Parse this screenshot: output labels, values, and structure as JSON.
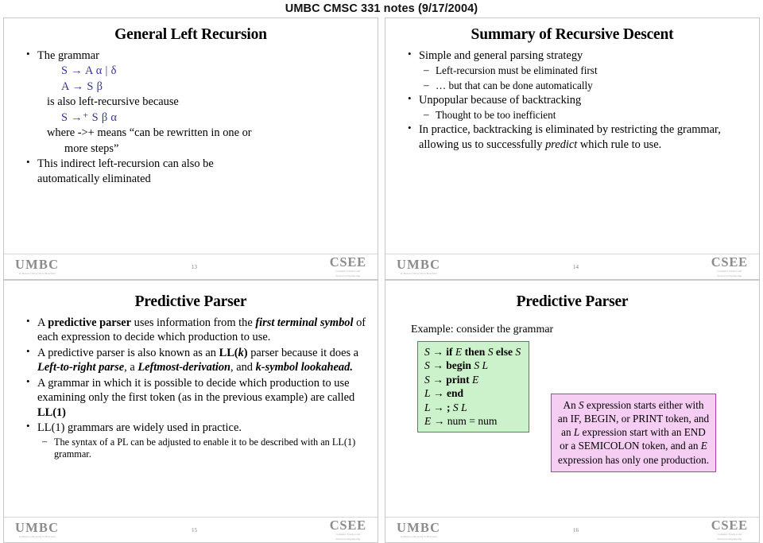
{
  "document": {
    "header": "UMBC CMSC 331 notes (9/17/2004)"
  },
  "logos": {
    "umbc_mark": "UMBC",
    "umbc_sub": "an Honors University in Maryland",
    "csee_mark": "CSEE",
    "csee_sub_line1": "Computer Science and",
    "csee_sub_line2": "Electrical Engineering"
  },
  "slides": [
    {
      "page_number": "13",
      "title": "General Left Recursion",
      "bullet1": "The grammar",
      "grammar1": "S → A α | δ",
      "grammar2": "A → S β",
      "because_line": "is also left-recursive because",
      "grammar3": "S →⁺ S β α",
      "where_line": "where ->+ means “can be rewritten in one or",
      "where_line2": "more steps”",
      "bullet2_line1": "This indirect left-recursion can also be",
      "bullet2_line2": "automatically eliminated"
    },
    {
      "page_number": "14",
      "title": "Summary of Recursive Descent",
      "b1": "Simple and general parsing strategy",
      "b1s1": "Left-recursion must be eliminated first",
      "b1s2": "… but that can be done automatically",
      "b2": "Unpopular because of backtracking",
      "b2s1": "Thought to be too inefficient",
      "b3_part1": "In practice, backtracking is eliminated by restricting the grammar, allowing us to successfully ",
      "b3_italic": "predict",
      "b3_part2": " which rule to use."
    },
    {
      "page_number": "15",
      "title": "Predictive Parser",
      "b1_a": "A ",
      "b1_bold1": "predictive parser",
      "b1_b": " uses information from the ",
      "b1_bi1": "first terminal symbol",
      "b1_c": " of each  expression to decide which production to use.",
      "b2_a": "A predictive parser is also known as an ",
      "b2_bold1": "LL(",
      "b2_boldital1": "k",
      "b2_bold2": ")",
      "b2_b": " parser because it does a ",
      "b2_bi1": "Left-to-right parse",
      "b2_c": ", a ",
      "b2_bi2": "Leftmost-derivation",
      "b2_d": ", and ",
      "b2_bi3": "k-symbol lookahead.",
      "b3_a": "A grammar in which it is possible to decide which production to use examining only the first token (as in the previous example) are called ",
      "b3_bold": "LL(1)",
      "b4": "LL(1) grammars are widely used in practice.",
      "b4s1": "The syntax of a PL can be adjusted to enable it to be described with an LL(1) grammar."
    },
    {
      "page_number": "16",
      "title": "Predictive Parser",
      "example_lead": "Example: consider the grammar",
      "grammar_rules": [
        {
          "lhs": "S",
          "arrow": "→",
          "rhs_parts": [
            {
              "t": "if ",
              "s": "b"
            },
            {
              "t": "E",
              "s": "i"
            },
            {
              "t": " then ",
              "s": "b"
            },
            {
              "t": "S",
              "s": "i"
            },
            {
              "t": " else ",
              "s": "b"
            },
            {
              "t": "S",
              "s": "i"
            }
          ]
        },
        {
          "lhs": "S",
          "arrow": "→",
          "rhs_parts": [
            {
              "t": "begin ",
              "s": "b"
            },
            {
              "t": "S L",
              "s": "i"
            }
          ]
        },
        {
          "lhs": "S",
          "arrow": "→",
          "rhs_parts": [
            {
              "t": "print ",
              "s": "b"
            },
            {
              "t": "E",
              "s": "i"
            }
          ]
        },
        {
          "lhs": "L",
          "arrow": "→",
          "rhs_parts": [
            {
              "t": "end",
              "s": "b"
            }
          ]
        },
        {
          "lhs": "L",
          "arrow": "→",
          "rhs_parts": [
            {
              "t": "; ",
              "s": "b"
            },
            {
              "t": "S L",
              "s": "i"
            }
          ]
        },
        {
          "lhs": "E",
          "arrow": "→",
          "rhs_parts": [
            {
              "t": "num = num",
              "s": "n"
            }
          ]
        }
      ],
      "note_a": "An ",
      "note_i1": "S",
      "note_b": " expression starts either with an IF, BEGIN, or PRINT token, and an ",
      "note_i2": "L",
      "note_c": " expression start with an END or a SEMICOLON token, and an ",
      "note_i3": "E",
      "note_d": " expression has only one production."
    }
  ]
}
